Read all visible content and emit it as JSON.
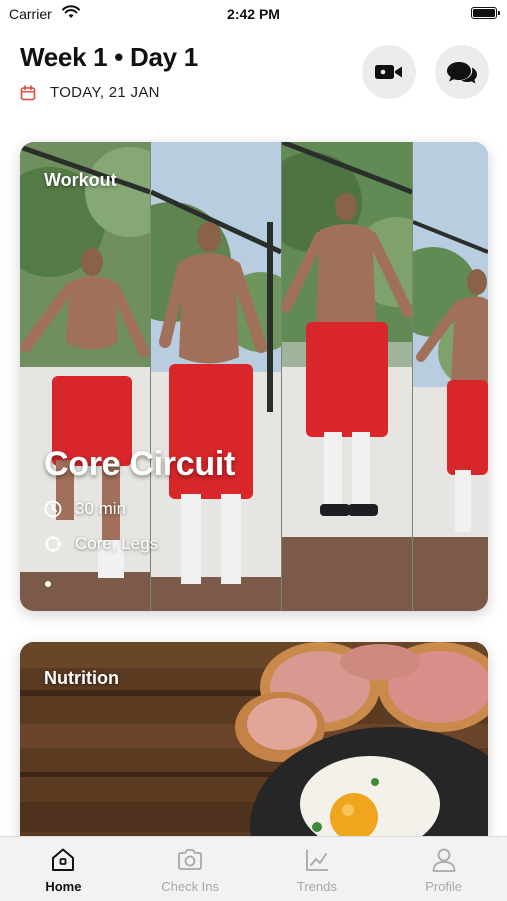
{
  "status_bar": {
    "carrier": "Carrier",
    "time": "2:42 PM"
  },
  "header": {
    "title": "Week 1 • Day 1",
    "date": "TODAY, 21 JAN",
    "buttons": [
      {
        "icon": "video-camera-icon"
      },
      {
        "icon": "chat-bubbles-icon"
      }
    ]
  },
  "workout_card": {
    "label": "Workout",
    "title": "Core Circuit",
    "duration": "30 min",
    "focus": "Core, Legs"
  },
  "nutrition_card": {
    "label": "Nutrition"
  },
  "tab_bar": {
    "tabs": [
      {
        "label": "Home",
        "icon": "home-icon",
        "active": true
      },
      {
        "label": "Check Ins",
        "icon": "camera-icon",
        "active": false
      },
      {
        "label": "Trends",
        "icon": "chart-icon",
        "active": false
      },
      {
        "label": "Profile",
        "icon": "profile-icon",
        "active": false
      }
    ]
  },
  "colors": {
    "accent_red": "#e0463a",
    "active_tab": "#111111",
    "inactive_tab": "#a8a8a8"
  }
}
